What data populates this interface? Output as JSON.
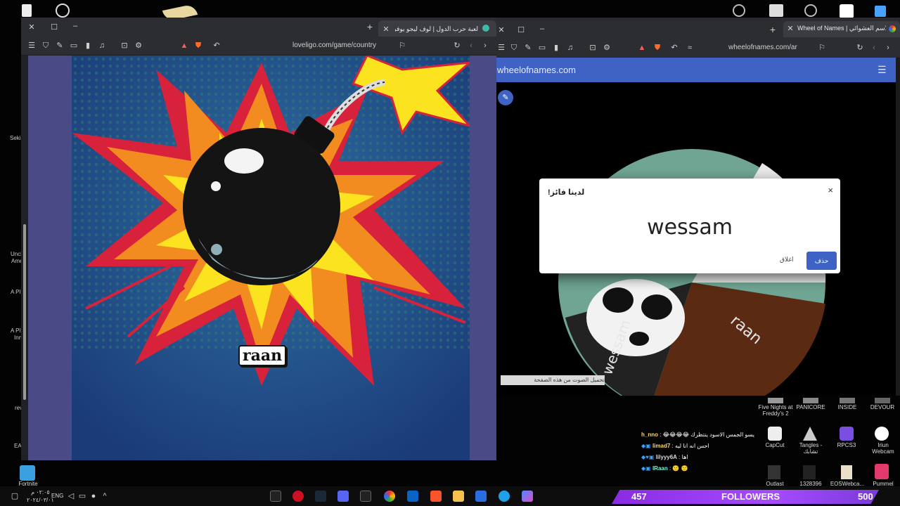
{
  "left_window": {
    "tab_title": "لعبة حرب الدول | لوف ليجو يوفر أ...",
    "url": "loveligo.com/game/country",
    "game": {
      "player_label": "raan",
      "close_symbol": "×"
    }
  },
  "right_window": {
    "tab_title": "Wheel of Names | الاسم العشوائي",
    "url": "wheelofnames.com/ar",
    "site_name": "wheelofnames.com",
    "dialog": {
      "title": "لدينا فائز!",
      "winner": "wessam",
      "remove_label": "حذف",
      "close_label": "اغلاق",
      "close_symbol": "×"
    },
    "wheel_labels": [
      "raan",
      "wessam"
    ],
    "status_tooltip": "تحميل الصوت من هذه الصفحة"
  },
  "desktop_icons": [
    {
      "label": "Five Nights at Freddy's 2"
    },
    {
      "label": "PANICORE"
    },
    {
      "label": "INSIDE"
    },
    {
      "label": "DEVOUR"
    },
    {
      "label": "CapCut"
    },
    {
      "label": "Tangles - تشابك"
    },
    {
      "label": "RPCS3"
    },
    {
      "label": "Iriun Webcam"
    },
    {
      "label": "Outlast"
    },
    {
      "label": "1328396"
    },
    {
      "label": "EOSWebca..."
    },
    {
      "label": "Pummel"
    },
    {
      "label": "Fortnite"
    }
  ],
  "left_strip": [
    "Seki",
    "Uncl",
    "Ame",
    "A Pl",
    "A Pl",
    "Inn",
    "rev",
    "EA"
  ],
  "chat": [
    {
      "user": "h_nno",
      "message": "😂😂😂😂 يسو الجمس الاسود ينتظرك"
    },
    {
      "user": "limad7",
      "message": "احس انه انا ليه"
    },
    {
      "user": "lilyyy6A",
      "message": "اها"
    },
    {
      "user": "lRaan",
      "message": "🙂 🙂"
    }
  ],
  "taskbar": {
    "lang": "ENG",
    "time": "٠٢:٠٥ م",
    "date": "٢٠٢٤/٠٣/٠١"
  },
  "followers": {
    "count": "457",
    "label": "FOLLOWERS",
    "goal": "500"
  },
  "colors": {
    "accent": "#3f63c4",
    "game_bg": "#1e3f78",
    "game_frame": "#4a4a86",
    "close_red": "#d21d2a",
    "followers_purple": "#a64bff"
  }
}
